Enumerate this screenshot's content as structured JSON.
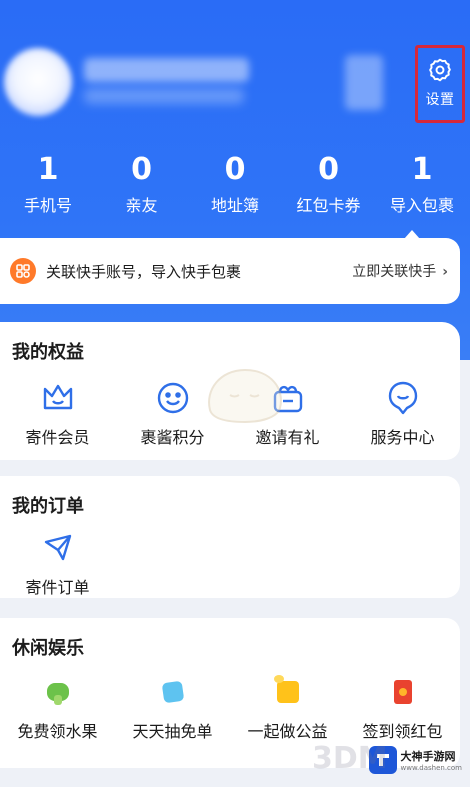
{
  "header": {
    "settings_label": "设置"
  },
  "stats": [
    {
      "num": "1",
      "label": "手机号"
    },
    {
      "num": "0",
      "label": "亲友"
    },
    {
      "num": "0",
      "label": "地址簿"
    },
    {
      "num": "0",
      "label": "红包卡券"
    },
    {
      "num": "1",
      "label": "导入包裹"
    }
  ],
  "link_card": {
    "text": "关联快手账号，导入快手包裹",
    "action": "立即关联快手",
    "icon": "link-badge-icon"
  },
  "benefits": {
    "title": "我的权益",
    "items": [
      {
        "label": "寄件会员",
        "icon": "crown-icon"
      },
      {
        "label": "裹酱积分",
        "icon": "smiley-icon"
      },
      {
        "label": "邀请有礼",
        "icon": "gift-icon"
      },
      {
        "label": "服务中心",
        "icon": "service-icon"
      }
    ]
  },
  "orders": {
    "title": "我的订单",
    "items": [
      {
        "label": "寄件订单",
        "icon": "send-icon"
      }
    ]
  },
  "leisure": {
    "title": "休闲娱乐",
    "items": [
      {
        "label": "免费领水果",
        "icon": "fruit-icon"
      },
      {
        "label": "天天抽免单",
        "icon": "lottery-icon"
      },
      {
        "label": "一起做公益",
        "icon": "charity-icon"
      },
      {
        "label": "签到领红包",
        "icon": "red-envelope-icon"
      }
    ]
  },
  "watermark": {
    "brand": "3DM",
    "name": "大神手游网",
    "url": "www.dashen.com"
  },
  "colors": {
    "brand_blue": "#2f74f7",
    "icon_blue": "#2f6fe8",
    "link_orange": "#ff7a2a",
    "highlight_red": "#d6283a"
  }
}
